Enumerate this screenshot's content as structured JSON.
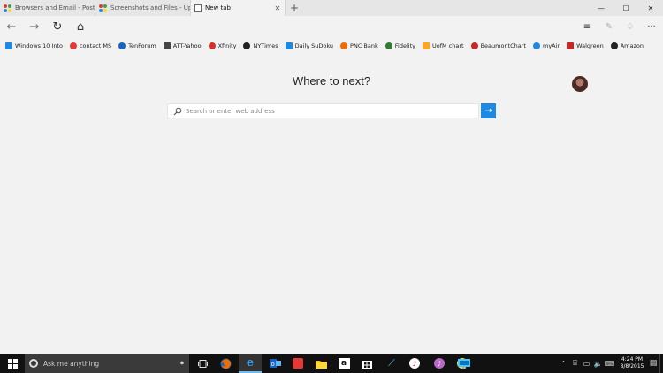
{
  "tabs": [
    {
      "label": "Browsers and Email - Post N",
      "active": false
    },
    {
      "label": "Screenshots and Files - Uplo",
      "active": false
    },
    {
      "label": "New tab",
      "active": true
    }
  ],
  "new_tab_symbol": "+",
  "window_controls": {
    "minimize": "—",
    "maximize": "☐",
    "close": "✕"
  },
  "nav": {
    "back": "←",
    "forward": "→",
    "refresh": "↻",
    "home": "⌂"
  },
  "toolbar_right": {
    "hub": "≡",
    "note": "✎",
    "share": "♤",
    "more": "···"
  },
  "favorites": [
    {
      "label": "Windows 10 Into",
      "icon": "windows-icon",
      "color": "#1e88e5"
    },
    {
      "label": "contact MS",
      "icon": "ms-icon",
      "color": "#e53935"
    },
    {
      "label": "TenForum",
      "icon": "tenforum-icon",
      "color": "#1565c0"
    },
    {
      "label": "ATT-Yahoo",
      "icon": "star-icon",
      "color": "#444444"
    },
    {
      "label": "Xfinity",
      "icon": "xfinity-icon",
      "color": "#d32f2f"
    },
    {
      "label": "NYTimes",
      "icon": "nyt-icon",
      "color": "#222222"
    },
    {
      "label": "Daily SuDoku",
      "icon": "sudoku-icon",
      "color": "#1e88e5"
    },
    {
      "label": "PNC Bank",
      "icon": "pnc-icon",
      "color": "#ef6c00"
    },
    {
      "label": "Fidelity",
      "icon": "fidelity-icon",
      "color": "#2e7d32"
    },
    {
      "label": "UofM chart",
      "icon": "uofm-icon",
      "color": "#f9a825"
    },
    {
      "label": "BeaumontChart",
      "icon": "beaumont-icon",
      "color": "#c62828"
    },
    {
      "label": "myAir",
      "icon": "myair-icon",
      "color": "#1e88e5"
    },
    {
      "label": "Walgreen",
      "icon": "walgreen-icon",
      "color": "#c62828"
    },
    {
      "label": "Amazon",
      "icon": "amazon-icon",
      "color": "#222222"
    }
  ],
  "heading": "Where to next?",
  "search": {
    "placeholder": "Search or enter web address",
    "value": ""
  },
  "go_symbol": "→",
  "taskbar": {
    "search_text": "Ask me anything",
    "mic_symbol": "🎤",
    "clock_time": "4:24 PM",
    "clock_date": "8/8/2015"
  },
  "colors": {
    "accent": "#1e88e5",
    "taskbar": "#111111",
    "page": "#f2f2f2"
  }
}
